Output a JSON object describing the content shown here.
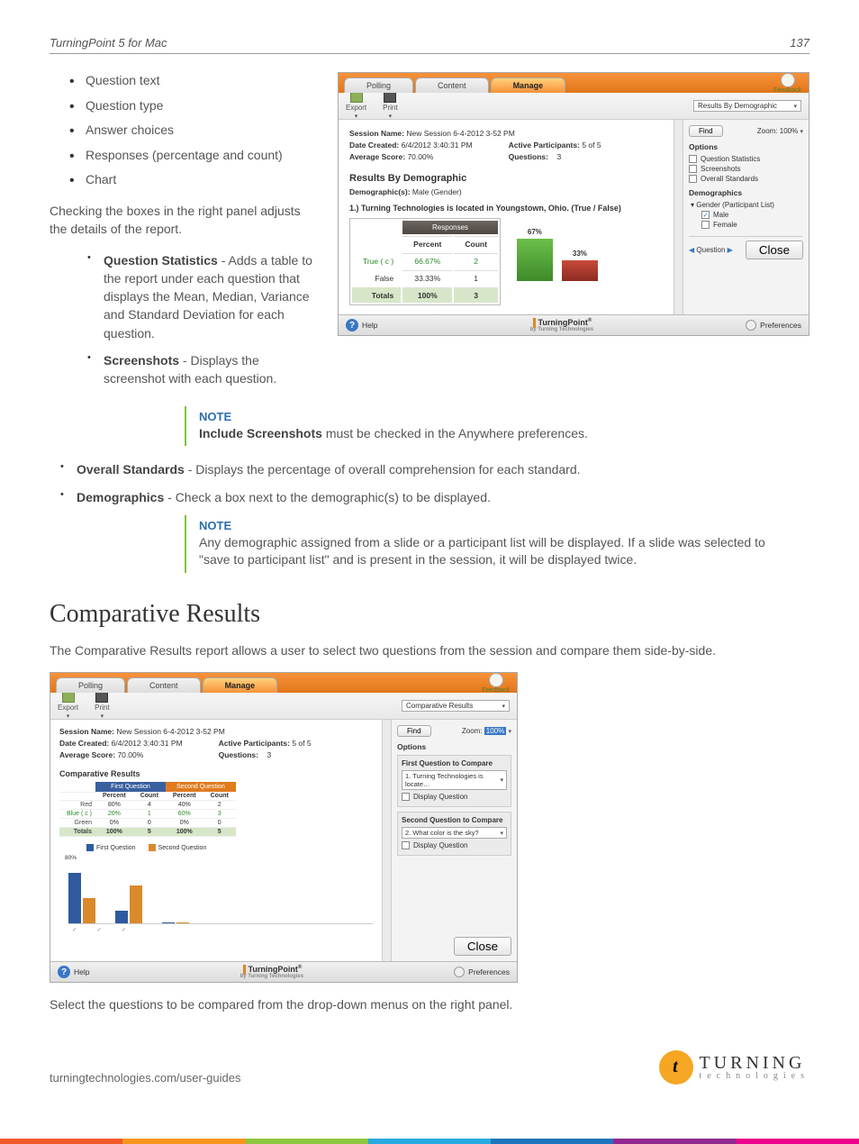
{
  "header": {
    "title": "TurningPoint 5 for Mac",
    "page_number": "137"
  },
  "left_bullets": [
    "Question text",
    "Question type",
    "Answer choices",
    "Responses (percentage and count)",
    "Chart"
  ],
  "left_para": "Checking the boxes in the right panel adjusts the details of the report.",
  "detail_items": [
    {
      "title": "Question Statistics",
      "body": " - Adds a table to the report under each question that displays the Mean, Median, Variance and Standard Deviation for each question."
    },
    {
      "title": "Screenshots",
      "body": " - Displays the screenshot with each question."
    }
  ],
  "note1": {
    "title": "NOTE",
    "body_prefix": "Include Screenshots",
    "body_rest": " must be checked in the Anywhere preferences."
  },
  "post_note_items": [
    {
      "title": "Overall Standards",
      "body": " - Displays the percentage of overall comprehension for each standard."
    },
    {
      "title": "Demographics",
      "body": " - Check a box next to the demographic(s) to be displayed."
    }
  ],
  "note2": {
    "title": "NOTE",
    "body": "Any demographic assigned from a slide or a participant list will be displayed. If a slide was selected to \"save to participant list\" and is present in the session, it will be displayed twice."
  },
  "comparative": {
    "heading": "Comparative Results",
    "intro": "The Comparative Results report allows a user to select two questions from the session and compare them side-by-side.",
    "outro": "Select the questions to be compared from the drop-down menus on the right panel."
  },
  "app1": {
    "tabs": [
      "Polling",
      "Content",
      "Manage"
    ],
    "feedback": "Feedback",
    "export": "Export",
    "print": "Print",
    "report_dropdown": "Results By Demographic",
    "session_name_label": "Session Name:",
    "session_name": "New Session 6-4-2012 3-52 PM",
    "date_created_label": "Date Created:",
    "date_created": "6/4/2012 3:40:31 PM",
    "avg_score_label": "Average Score:",
    "avg_score": "70.00%",
    "active_label": "Active Participants:",
    "active_val": "5 of 5",
    "questions_label": "Questions:",
    "questions_val": "3",
    "section_title": "Results By Demographic",
    "demographic_label": "Demographic(s):",
    "demographic_val": "Male (Gender)",
    "q_text": "1.) Turning Technologies is located in Youngstown, Ohio. (True / False)",
    "responses_header": "Responses",
    "col_percent": "Percent",
    "col_count": "Count",
    "rows": [
      {
        "label": "True ( c )",
        "percent": "66.67%",
        "count": "2",
        "correct": true
      },
      {
        "label": "False",
        "percent": "33.33%",
        "count": "1",
        "correct": false
      }
    ],
    "totals_label": "Totals",
    "totals_percent": "100%",
    "totals_count": "3",
    "bar1_pct": "67%",
    "bar2_pct": "33%",
    "side": {
      "find": "Find",
      "zoom_label": "Zoom:",
      "zoom_val": "100%",
      "options": "Options",
      "opt_qstats": "Question Statistics",
      "opt_screens": "Screenshots",
      "opt_overall": "Overall Standards",
      "demographics": "Demographics",
      "demo_group": "Gender (Participant List)",
      "demo_male": "Male",
      "demo_female": "Female",
      "question_nav": "Question",
      "close": "Close"
    },
    "help": "Help",
    "tp_brand": "TurningPoint",
    "tp_sub": "by Turning Technologies",
    "prefs": "Preferences"
  },
  "app2": {
    "tabs": [
      "Polling",
      "Content",
      "Manage"
    ],
    "feedback": "Feedback",
    "export": "Export",
    "print": "Print",
    "report_dropdown": "Comparative Results",
    "session_name_label": "Session Name:",
    "session_name": "New Session 6-4-2012 3-52 PM",
    "date_created_label": "Date Created:",
    "date_created": "6/4/2012 3:40:31 PM",
    "avg_score_label": "Average Score:",
    "avg_score": "70.00%",
    "active_label": "Active Participants:",
    "active_val": "5 of 5",
    "questions_label": "Questions:",
    "questions_val": "3",
    "section_title": "Comparative Results",
    "first_q_header": "First Question",
    "second_q_header": "Second Question",
    "col_percent": "Percent",
    "col_count": "Count",
    "rows": [
      {
        "label": "Red",
        "p1": "80%",
        "c1": "4",
        "p2": "40%",
        "c2": "2"
      },
      {
        "label": "Blue ( c )",
        "p1": "20%",
        "c1": "1",
        "p2": "60%",
        "c2": "3",
        "correct": true
      },
      {
        "label": "Green",
        "p1": "0%",
        "c1": "0",
        "p2": "0%",
        "c2": "0"
      }
    ],
    "totals_label": "Totals",
    "t_p1": "100%",
    "t_c1": "5",
    "t_p2": "100%",
    "t_c2": "5",
    "legend_first": "First Question",
    "legend_second": "Second Question",
    "side": {
      "find": "Find",
      "zoom_label": "Zoom:",
      "zoom_val": "100%",
      "options": "Options",
      "first_compare": "First Question to Compare",
      "first_sel": "1. Turning Technologies is locate…",
      "display_q": "Display Question",
      "second_compare": "Second Question to Compare",
      "second_sel": "2. What color is the sky?",
      "close": "Close"
    },
    "help": "Help",
    "tp_brand": "TurningPoint",
    "tp_sub": "by Turning Technologies",
    "prefs": "Preferences"
  },
  "chart_data": [
    {
      "type": "bar",
      "title": "Results By Demographic — Q1 True/False",
      "categories": [
        "True",
        "False"
      ],
      "values": [
        67,
        33
      ],
      "ylabel": "Percent",
      "ylim": [
        0,
        100
      ],
      "colors": [
        "#4a9b3b",
        "#b02d22"
      ]
    },
    {
      "type": "bar",
      "title": "Comparative Results",
      "categories": [
        "Red",
        "Blue",
        "Green"
      ],
      "series": [
        {
          "name": "First Question",
          "values": [
            80,
            20,
            0
          ],
          "color": "#2f5a9e"
        },
        {
          "name": "Second Question",
          "values": [
            40,
            60,
            0
          ],
          "color": "#d98a2b"
        }
      ],
      "ylabel": "Percent",
      "ylim": [
        0,
        100
      ]
    }
  ],
  "footer": {
    "url": "turningtechnologies.com/user-guides",
    "logo_big": "TURNING",
    "logo_small": "technologies"
  },
  "rainbow_colors": [
    "#f15a29",
    "#f7941e",
    "#8dc63f",
    "#27aae1",
    "#1c75bc",
    "#92278f",
    "#ec008c"
  ]
}
